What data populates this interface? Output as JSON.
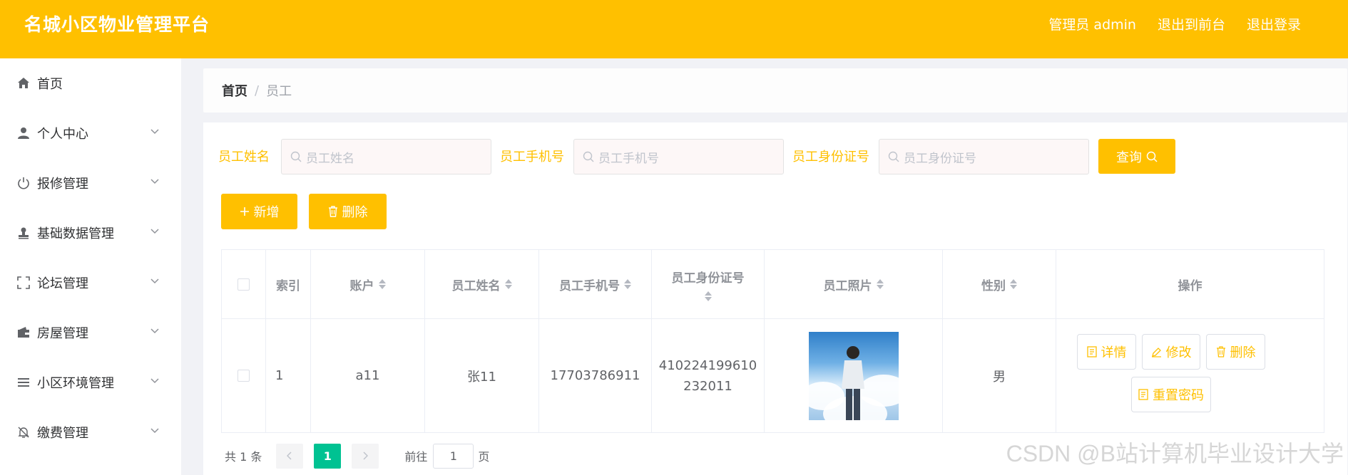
{
  "app": {
    "title": "名城小区物业管理平台"
  },
  "header": {
    "admin_label": "管理员 admin",
    "to_front": "退出到前台",
    "logout": "退出登录",
    "accent_color": "#ffc000"
  },
  "sidebar": {
    "items": [
      {
        "label": "首页",
        "icon": "home-icon",
        "has_children": false
      },
      {
        "label": "个人中心",
        "icon": "user-icon",
        "has_children": true
      },
      {
        "label": "报修管理",
        "icon": "power-icon",
        "has_children": true
      },
      {
        "label": "基础数据管理",
        "icon": "stamp-icon",
        "has_children": true
      },
      {
        "label": "论坛管理",
        "icon": "fullscreen-icon",
        "has_children": true
      },
      {
        "label": "房屋管理",
        "icon": "wallet-icon",
        "has_children": true
      },
      {
        "label": "小区环境管理",
        "icon": "list-icon",
        "has_children": true
      },
      {
        "label": "缴费管理",
        "icon": "bell-off-icon",
        "has_children": true
      }
    ]
  },
  "breadcrumb": {
    "home": "首页",
    "separator": "/",
    "current": "员工"
  },
  "filters": {
    "name_label": "员工姓名",
    "name_placeholder": "员工姓名",
    "phone_label": "员工手机号",
    "phone_placeholder": "员工手机号",
    "id_label": "员工身份证号",
    "id_placeholder": "员工身份证号",
    "query_button": "查询"
  },
  "actions": {
    "add": "新增",
    "delete": "删除"
  },
  "table": {
    "columns": [
      "索引",
      "账户",
      "员工姓名",
      "员工手机号",
      "员工身份证号",
      "员工照片",
      "性别",
      "操作"
    ],
    "rows": [
      {
        "index": "1",
        "account": "a11",
        "name": "张11",
        "phone": "17703786911",
        "id_line1": "410224199610",
        "id_line2": "232011",
        "gender": "男",
        "ops": {
          "detail": "详情",
          "edit": "修改",
          "delete": "删除",
          "reset": "重置密码"
        }
      }
    ]
  },
  "pagination": {
    "total": "共 1 条",
    "current_page": "1",
    "goto_label": "前往",
    "goto_value": "1",
    "page_suffix": "页",
    "active_color": "#00c292"
  },
  "watermark": "CSDN @B站计算机毕业设计大学"
}
